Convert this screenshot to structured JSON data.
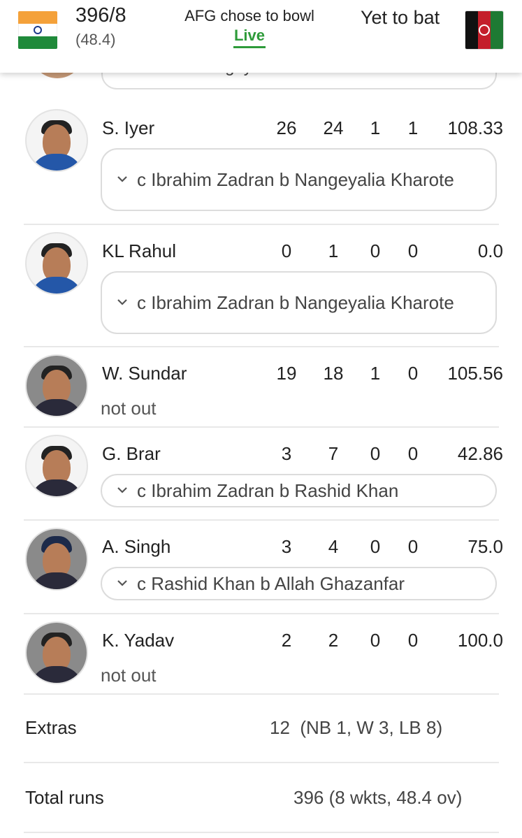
{
  "header": {
    "team1_score": "396/8",
    "team1_overs": "(48.4)",
    "status": "AFG chose to bowl",
    "live_label": "Live",
    "team2_status": "Yet to bat",
    "accent_color": "#2e9b3a"
  },
  "partial_row": {
    "dismissal": "c sub b Nangeyalia Kharote"
  },
  "players": [
    {
      "name": "S. Iyer",
      "runs": "26",
      "balls": "24",
      "fours": "1",
      "sixes": "1",
      "sr": "108.33",
      "dismissal": "c Ibrahim Zadran b Nangeyalia Kharote"
    },
    {
      "name": "KL Rahul",
      "runs": "0",
      "balls": "1",
      "fours": "0",
      "sixes": "0",
      "sr": "0.0",
      "dismissal": "c Ibrahim Zadran b Nangeyalia Kharote"
    },
    {
      "name": "W. Sundar",
      "runs": "19",
      "balls": "18",
      "fours": "1",
      "sixes": "0",
      "sr": "105.56",
      "dismissal": "not out"
    },
    {
      "name": "G. Brar",
      "runs": "3",
      "balls": "7",
      "fours": "0",
      "sixes": "0",
      "sr": "42.86",
      "dismissal": "c Ibrahim Zadran b Rashid Khan"
    },
    {
      "name": "A. Singh",
      "runs": "3",
      "balls": "4",
      "fours": "0",
      "sixes": "0",
      "sr": "75.0",
      "dismissal": "c Rashid Khan b Allah Ghazanfar"
    },
    {
      "name": "K. Yadav",
      "runs": "2",
      "balls": "2",
      "fours": "0",
      "sixes": "0",
      "sr": "100.0",
      "dismissal": "not out"
    }
  ],
  "extras": {
    "label": "Extras",
    "value": "12",
    "detail": "(NB 1, W 3, LB 8)"
  },
  "total": {
    "label": "Total runs",
    "value": "396",
    "detail": "(8 wkts, 48.4 ov)"
  }
}
